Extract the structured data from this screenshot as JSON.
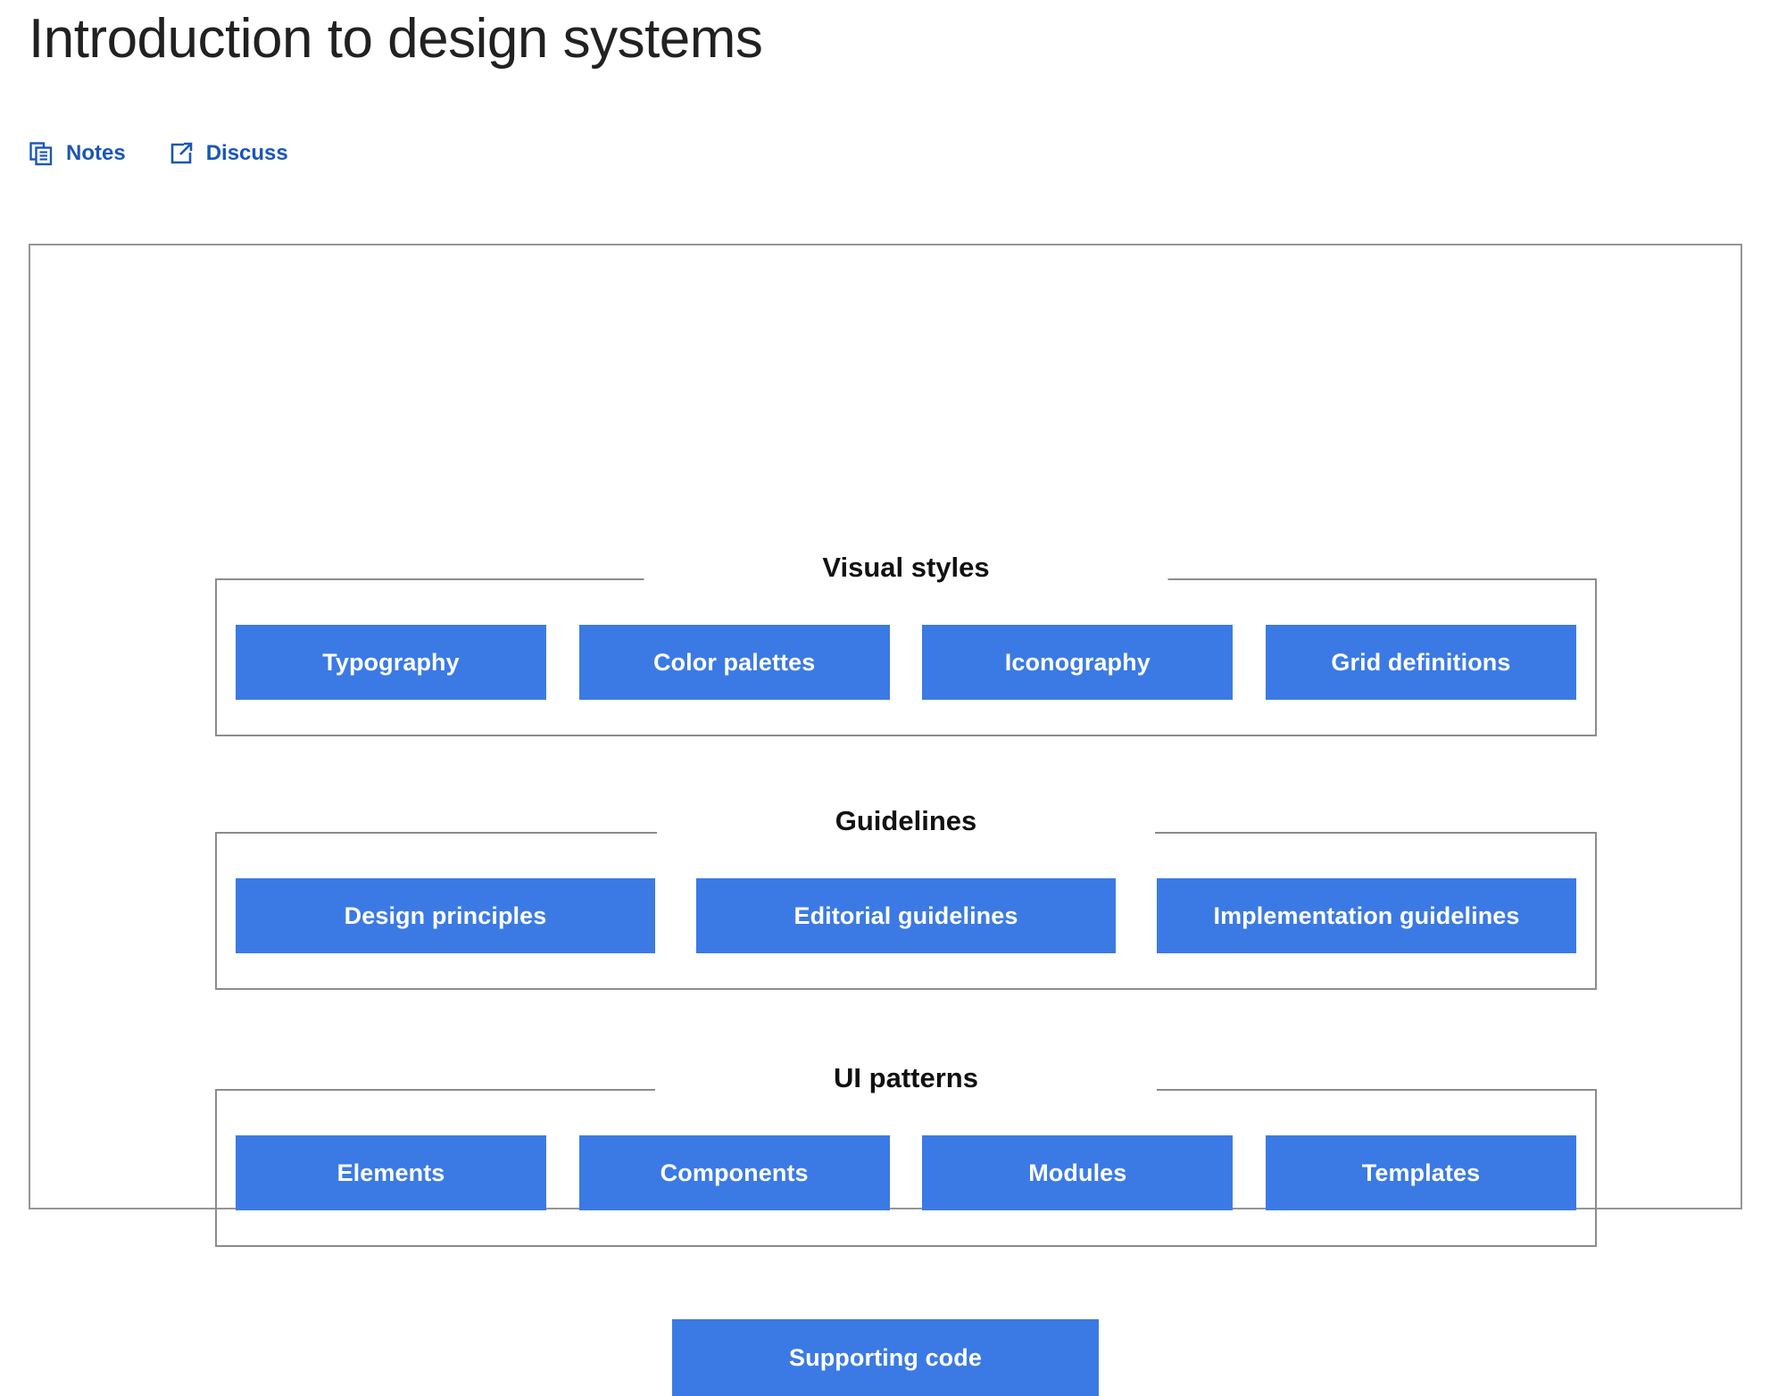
{
  "page": {
    "title": "Introduction to design systems"
  },
  "actions": [
    {
      "label": "Notes",
      "icon": "notes-icon"
    },
    {
      "label": "Discuss",
      "icon": "external-link-icon"
    }
  ],
  "colors": {
    "chip_blue": "#3b7ae4",
    "link_blue": "#1a56b8",
    "border_gray": "#8c8c8c",
    "card_border": "#969696",
    "title_text": "#212121",
    "caption_text": "#111111"
  },
  "diagram": {
    "groups": [
      {
        "caption": "Visual styles",
        "items": [
          "Typography",
          "Color palettes",
          "Iconography",
          "Grid definitions"
        ]
      },
      {
        "caption": "Guidelines",
        "items": [
          "Design principles",
          "Editorial guidelines",
          "Implementation guidelines"
        ]
      },
      {
        "caption": "UI patterns",
        "items": [
          "Elements",
          "Components",
          "Modules",
          "Templates"
        ]
      }
    ],
    "standalone": {
      "label": "Supporting code"
    }
  }
}
